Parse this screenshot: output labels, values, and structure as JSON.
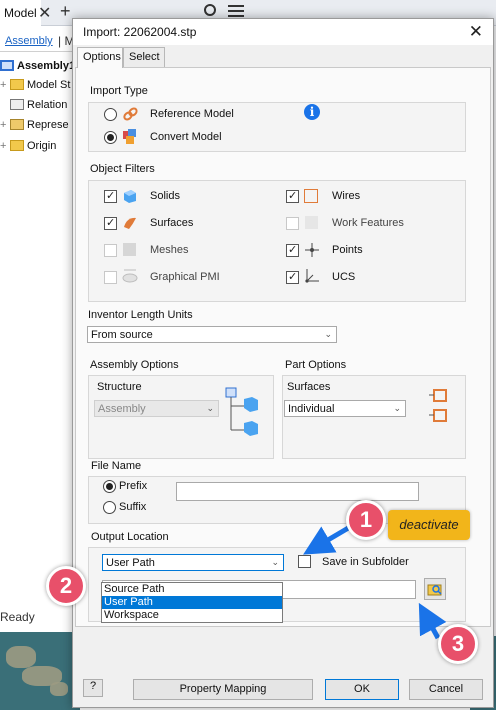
{
  "background": {
    "tab_label": "Model",
    "close_glyph": "✕",
    "plus_glyph": "+",
    "assembly_link": "Assembly",
    "separator": "| M",
    "tree": [
      {
        "label": "Assembly1",
        "icon": "assembly-icon"
      },
      {
        "label": "Model St",
        "icon": "folder-icon"
      },
      {
        "label": "Relation",
        "icon": "relationships-icon"
      },
      {
        "label": "Represe",
        "icon": "representations-icon"
      },
      {
        "label": "Origin",
        "icon": "origin-icon"
      }
    ],
    "status": "Ready"
  },
  "dialog": {
    "title": "Import:  22062004.stp",
    "close": "✕",
    "tabs": [
      "Options",
      "Select"
    ],
    "import_type": {
      "label": "Import Type",
      "options": [
        {
          "label": "Reference Model",
          "checked": false
        },
        {
          "label": "Convert Model",
          "checked": true
        }
      ],
      "info_glyph": "i"
    },
    "object_filters": {
      "label": "Object Filters",
      "left": [
        {
          "label": "Solids",
          "checked": true,
          "enabled": true
        },
        {
          "label": "Surfaces",
          "checked": true,
          "enabled": true
        },
        {
          "label": "Meshes",
          "checked": false,
          "enabled": false
        },
        {
          "label": "Graphical PMI",
          "checked": false,
          "enabled": false
        }
      ],
      "right": [
        {
          "label": "Wires",
          "checked": true,
          "enabled": true
        },
        {
          "label": "Work Features",
          "checked": false,
          "enabled": false
        },
        {
          "label": "Points",
          "checked": true,
          "enabled": true
        },
        {
          "label": "UCS",
          "checked": true,
          "enabled": true
        }
      ]
    },
    "length_units": {
      "label": "Inventor Length Units",
      "value": "From source"
    },
    "assembly_options": {
      "label": "Assembly Options",
      "structure_label": "Structure",
      "structure_value": "Assembly"
    },
    "part_options": {
      "label": "Part Options",
      "surfaces_label": "Surfaces",
      "surfaces_value": "Individual"
    },
    "file_name": {
      "label": "File Name",
      "options": [
        {
          "label": "Prefix",
          "checked": true
        },
        {
          "label": "Suffix",
          "checked": false
        }
      ],
      "value": ""
    },
    "output_location": {
      "label": "Output Location",
      "selected": "User Path",
      "options": [
        "Source Path",
        "User Path",
        "Workspace"
      ],
      "highlighted": "User Path",
      "path_value": "",
      "save_in_subfolder": {
        "label": "Save in Subfolder",
        "checked": false
      }
    },
    "buttons": {
      "help": "?",
      "property_mapping": "Property Mapping",
      "ok": "OK",
      "cancel": "Cancel"
    }
  },
  "annotations": {
    "badge1": "1",
    "badge2": "2",
    "badge3": "3",
    "callout": "deactivate",
    "badge_color": "#e8506a",
    "callout_color": "#f2b51a",
    "arrow_color": "#1a73e8"
  }
}
